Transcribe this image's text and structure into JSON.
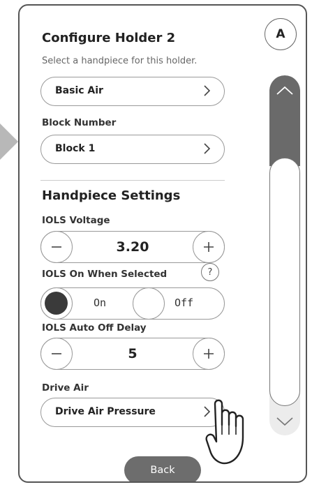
{
  "header": {
    "title": "Configure Holder 2",
    "subtitle": "Select a handpiece for this holder.",
    "avatar_letter": "A"
  },
  "handpiece_select": {
    "value": "Basic Air"
  },
  "block": {
    "label": "Block Number",
    "value": "Block 1"
  },
  "settings": {
    "heading": "Handpiece Settings",
    "iols_voltage": {
      "label": "IOLS Voltage",
      "value": "3.20"
    },
    "iols_on_when_selected": {
      "label": "IOLS On When Selected",
      "options": [
        "On",
        "Off"
      ],
      "selected": "On"
    },
    "iols_auto_off_delay": {
      "label": "IOLS Auto Off Delay",
      "value": "5"
    },
    "drive_air": {
      "label": "Drive Air",
      "value": "Drive Air Pressure"
    }
  },
  "footer": {
    "back_label": "Back"
  },
  "scroll": {
    "position": 0.1
  },
  "colors": {
    "accent": "#6a6a6a",
    "border": "#999999"
  },
  "icons": [
    "chevron-right-icon",
    "minus-icon",
    "plus-icon",
    "help-icon",
    "chevron-up-icon",
    "chevron-down-icon",
    "hand-pointer-icon",
    "page-arrow-icon"
  ]
}
